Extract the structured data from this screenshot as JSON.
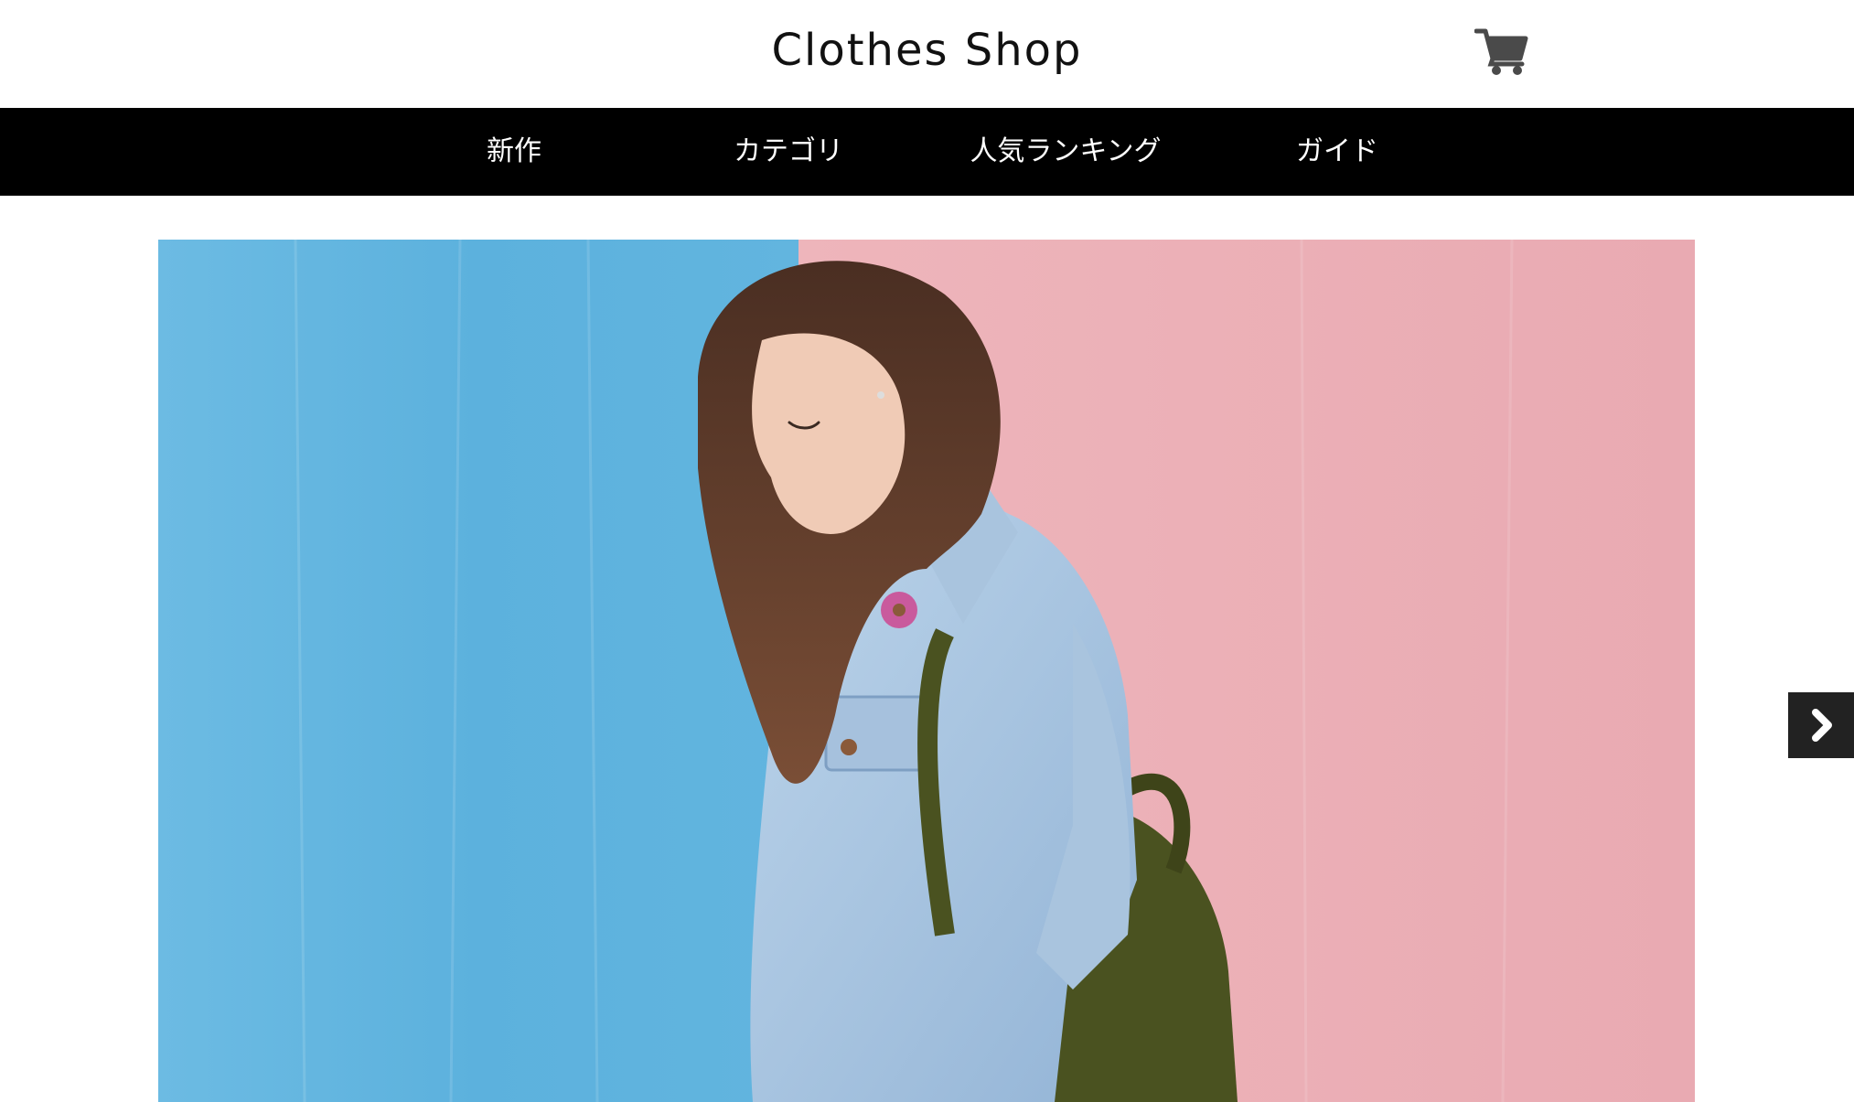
{
  "header": {
    "site_title": "Clothes Shop",
    "cart_icon": "shopping-cart-icon"
  },
  "nav": {
    "items": [
      {
        "label": "新作"
      },
      {
        "label": "カテゴリ"
      },
      {
        "label": "人気ランキング"
      },
      {
        "label": "ガイド"
      }
    ]
  },
  "hero": {
    "image": "hero-photo-woman-denim-jacket",
    "next_icon": "chevron-right-icon"
  },
  "colors": {
    "nav_bg": "#000000",
    "nav_text": "#ffffff",
    "hero_left": "#5fb4e0",
    "hero_right": "#eeb1b8",
    "next_btn_bg": "#222222"
  }
}
